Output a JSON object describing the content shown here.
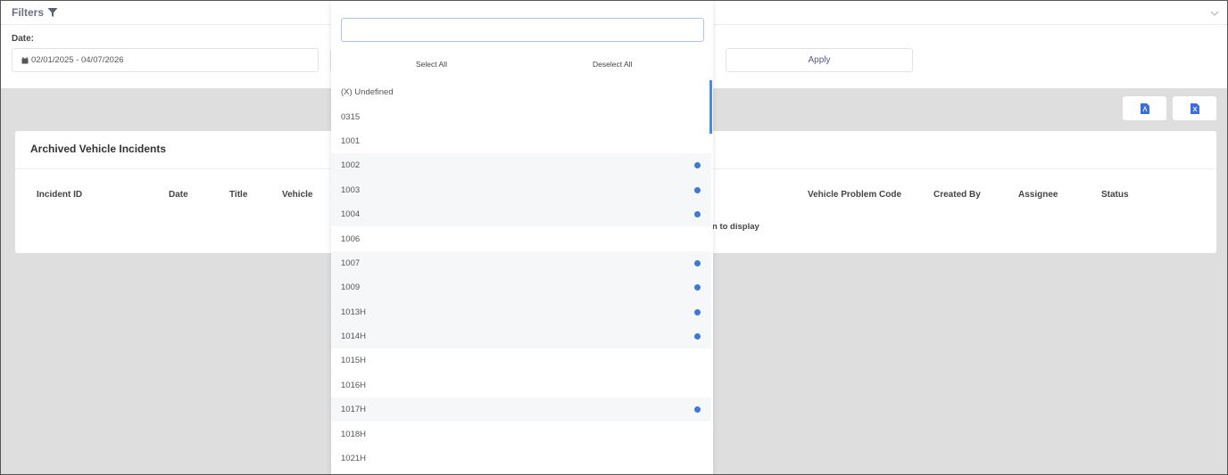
{
  "filters": {
    "title": "Filters",
    "date_label": "Date:",
    "date_value": "02/01/2025 - 04/07/2026",
    "apply_label": "Apply"
  },
  "dropdown": {
    "search_value": "",
    "select_all_label": "Select All",
    "deselect_all_label": "Deselect All",
    "items": [
      {
        "label": "(X) Undefined",
        "selected": false
      },
      {
        "label": "0315",
        "selected": false
      },
      {
        "label": "1001",
        "selected": false
      },
      {
        "label": "1002",
        "selected": true
      },
      {
        "label": "1003",
        "selected": true
      },
      {
        "label": "1004",
        "selected": true
      },
      {
        "label": "1006",
        "selected": false
      },
      {
        "label": "1007",
        "selected": true
      },
      {
        "label": "1009",
        "selected": true
      },
      {
        "label": "1013H",
        "selected": true
      },
      {
        "label": "1014H",
        "selected": true
      },
      {
        "label": "1015H",
        "selected": false
      },
      {
        "label": "1016H",
        "selected": false
      },
      {
        "label": "1017H",
        "selected": true
      },
      {
        "label": "1018H",
        "selected": false
      },
      {
        "label": "1021H",
        "selected": false
      }
    ]
  },
  "card": {
    "title": "Archived Vehicle Incidents",
    "columns": {
      "incident_id": "Incident ID",
      "date": "Date",
      "title": "Title",
      "vehicle": "Vehicle",
      "problem_code": "Vehicle Problem Code",
      "created_by": "Created By",
      "assignee": "Assignee",
      "status": "Status"
    },
    "no_data_text": "n to display"
  },
  "colors": {
    "accent": "#3d79d9",
    "export_icon": "#3b6fd8",
    "content_bg": "#dedede"
  },
  "icons": {
    "filter": "funnel-icon",
    "collapse": "chevron-down-icon",
    "calendar": "calendar-icon",
    "export_pdf": "pdf-file-icon",
    "export_excel": "excel-file-icon"
  }
}
